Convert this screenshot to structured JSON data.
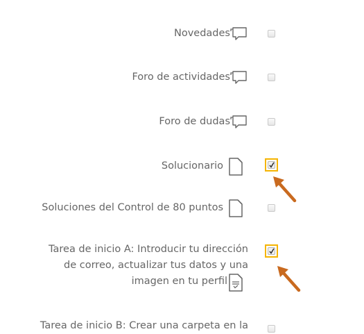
{
  "items": [
    {
      "label": "Novedades",
      "icon": "forum-icon",
      "checked": false
    },
    {
      "label": "Foro de actividades",
      "icon": "forum-icon",
      "checked": false
    },
    {
      "label": "Foro de dudas",
      "icon": "forum-icon",
      "checked": false
    },
    {
      "label": "Solucionario",
      "icon": "file-icon",
      "checked": true,
      "highlighted": true
    },
    {
      "label": "Soluciones del Control de 80 puntos",
      "icon": "file-icon",
      "checked": false
    },
    {
      "label_lines": [
        "Tarea de inicio A: Introducir tu dirección",
        "de correo, actualizar tus datos y una",
        "imagen en tu perfil"
      ],
      "icon": "assignment-icon",
      "checked": true,
      "highlighted": true
    },
    {
      "label": "Tarea de inicio B: Crear una carpeta en la",
      "icon": "",
      "checked": false
    }
  ],
  "colors": {
    "text": "#666666",
    "highlight_border": "#f5b400",
    "arrow": "#c96a1f",
    "checkbox_border": "#c9c9c9"
  }
}
